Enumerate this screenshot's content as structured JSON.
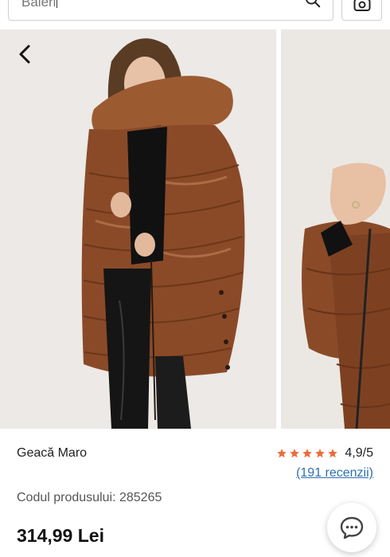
{
  "search": {
    "value": "Baleri",
    "placeholder": ""
  },
  "gallery": {
    "main_image_alt": "Geacă Maro - main photo",
    "next_image_alt": "Geacă Maro - detail photo"
  },
  "product": {
    "name": "Geacă Maro",
    "rating_value": "4,9/5",
    "rating_stars": 5,
    "reviews_link": "(191 recenzii)",
    "code_label": "Codul produsului:",
    "code_value": "285265",
    "price": "314,99 Lei"
  },
  "colors": {
    "star": "#e96d3c",
    "link": "#2f6fb0",
    "jacket": "#8a4a28"
  },
  "icons": {
    "search": "search-icon",
    "camera": "camera-icon",
    "back": "chevron-left-icon",
    "chat": "chat-bubble-icon",
    "star": "star-icon"
  }
}
